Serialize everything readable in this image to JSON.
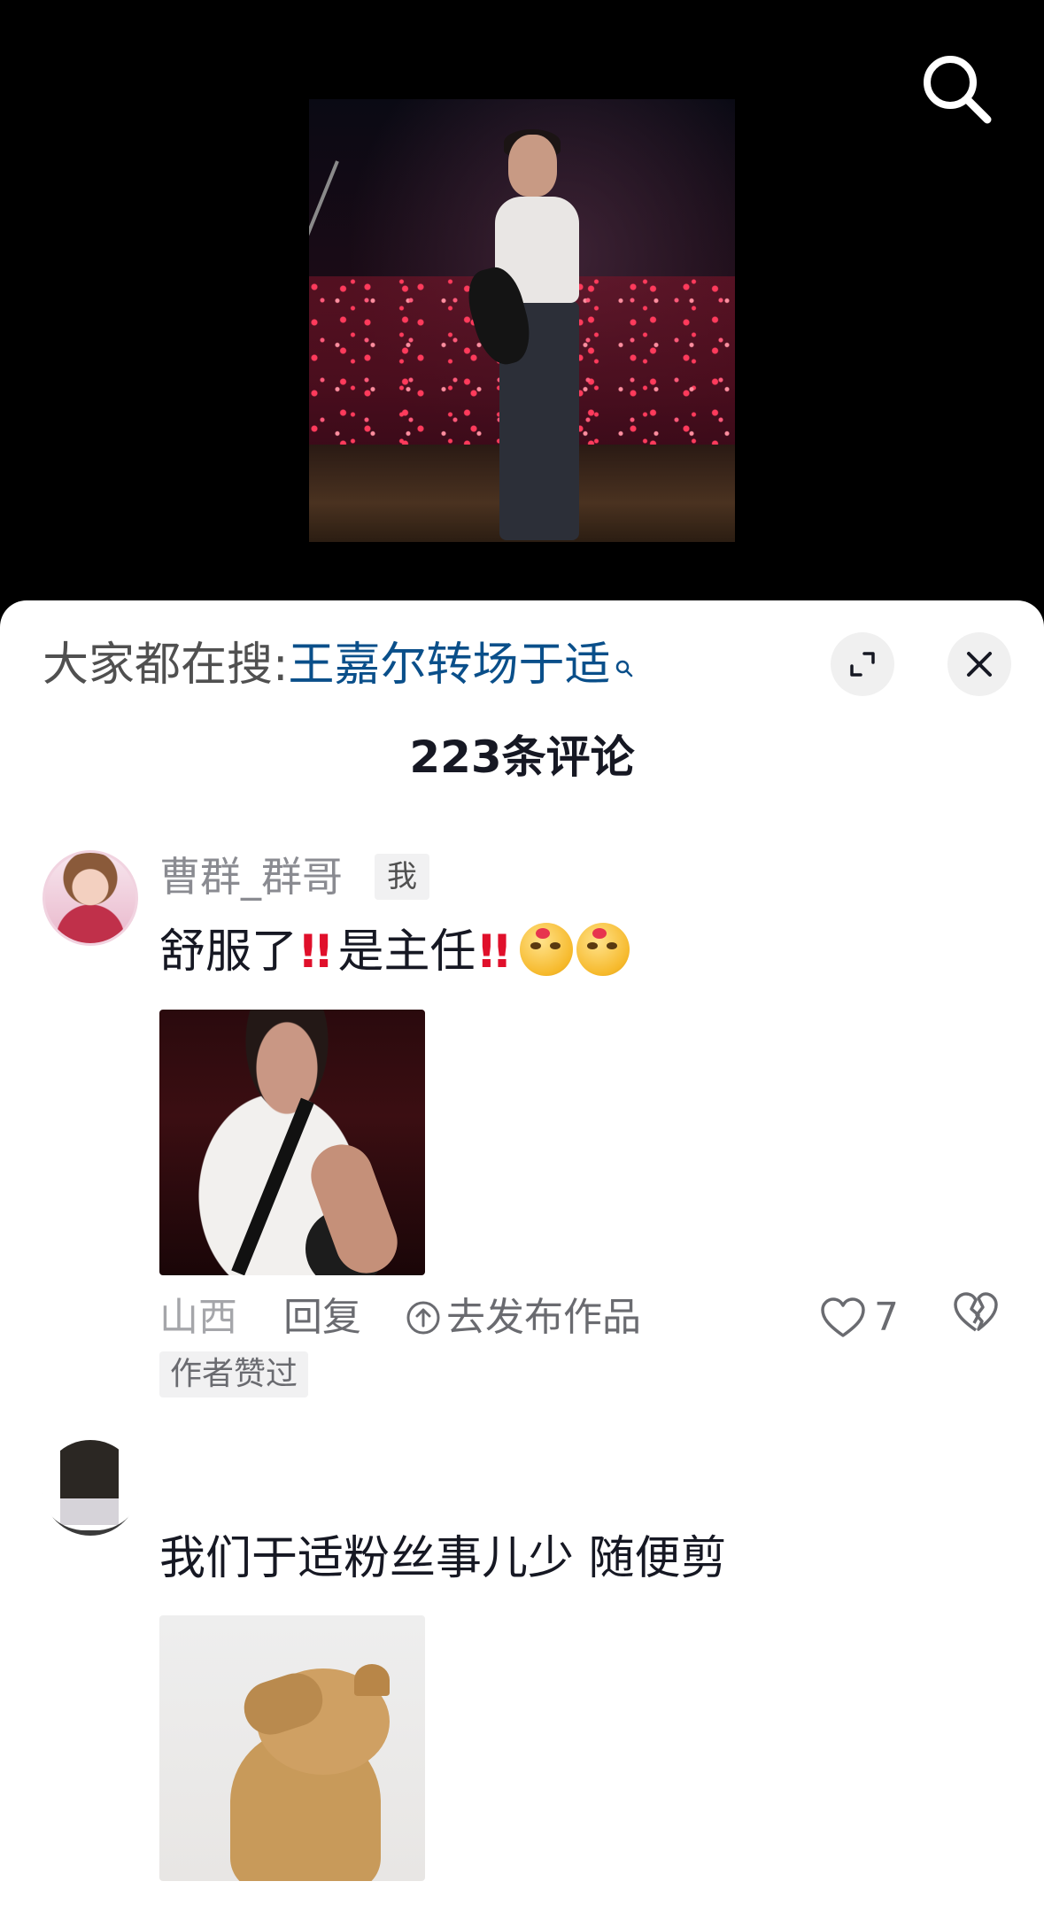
{
  "video": {
    "search_icon": "search-icon"
  },
  "sheet": {
    "search_tip": {
      "prefix": "大家都在搜:",
      "keyword": "王嘉尔转场于适"
    },
    "comment_count": "223条评论",
    "expand_icon": "expand-icon",
    "close_icon": "close-icon"
  },
  "comments": [
    {
      "username": "曹群_群哥",
      "badge": "我",
      "text_parts": [
        "舒服了",
        "!!",
        "是主任",
        "!!"
      ],
      "location": "山西",
      "reply_label": "回复",
      "publish_label": "去发布作品",
      "like_count": "7",
      "author_liked": "作者赞过"
    },
    {
      "username": "",
      "text": "我们于适粉丝事儿少 随便剪"
    }
  ],
  "colors": {
    "keyword_blue": "#0a4f8a",
    "bang_red": "#e0102b",
    "secondary_text": "#8a8b91"
  }
}
